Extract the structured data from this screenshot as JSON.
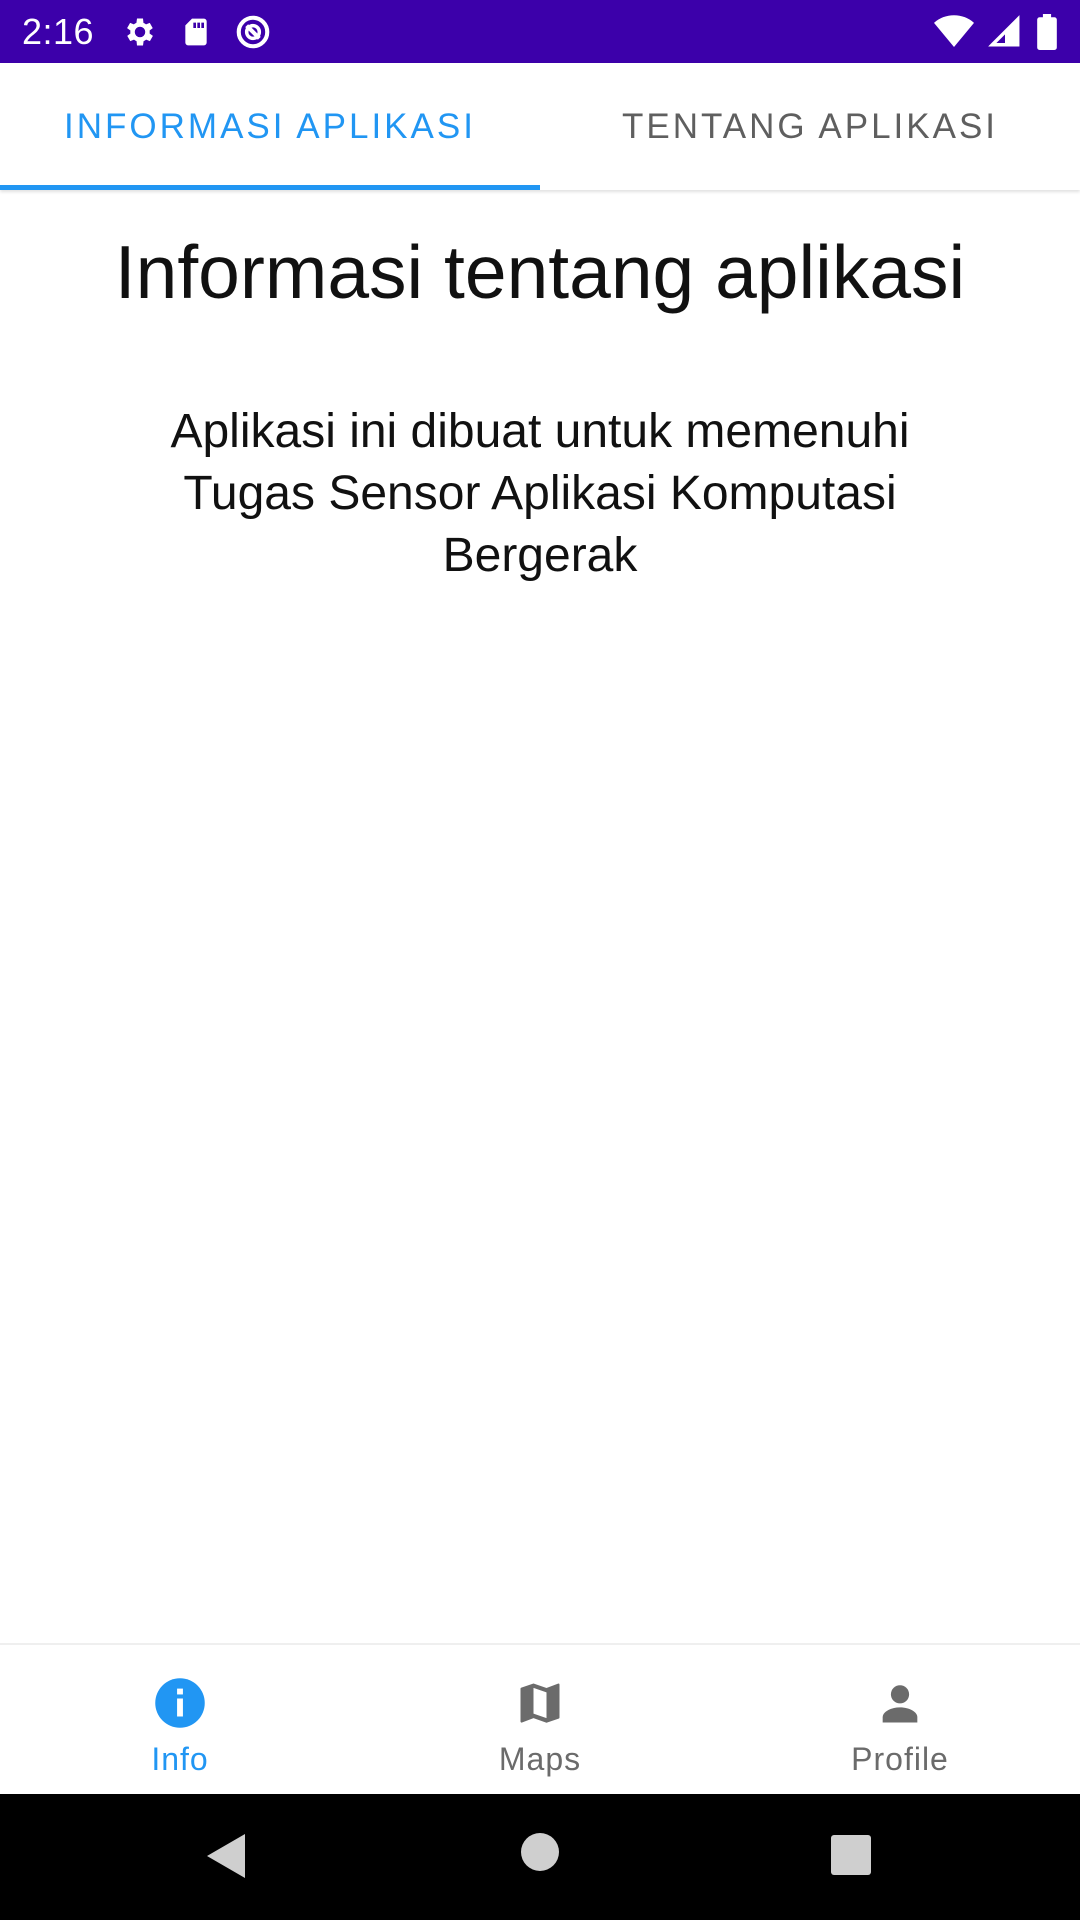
{
  "status_bar": {
    "time": "2:16",
    "background_color": "#3c00aa",
    "left_icons": [
      "gear-icon",
      "sd-card-icon",
      "sync-icon"
    ],
    "right_icons": [
      "wifi-icon",
      "cell-signal-icon",
      "battery-icon"
    ]
  },
  "tabs": [
    {
      "label": "INFORMASI APLIKASI",
      "active": true
    },
    {
      "label": "TENTANG APLIKASI",
      "active": false
    }
  ],
  "main": {
    "title": "Informasi tentang aplikasi",
    "description": "Aplikasi ini dibuat untuk memenuhi Tugas Sensor Aplikasi Komputasi Bergerak"
  },
  "bottom_nav": {
    "items": [
      {
        "label": "Info",
        "icon": "info-icon",
        "active": true
      },
      {
        "label": "Maps",
        "icon": "map-icon",
        "active": false
      },
      {
        "label": "Profile",
        "icon": "person-icon",
        "active": false
      }
    ]
  },
  "system_nav": {
    "buttons": [
      "back-icon",
      "home-icon",
      "recents-icon"
    ]
  },
  "colors": {
    "accent": "#2196f3",
    "inactive": "#6b6b6b"
  }
}
